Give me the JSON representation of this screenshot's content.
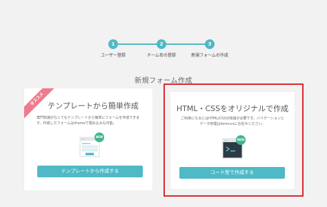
{
  "stepper": {
    "steps": [
      {
        "number": "1",
        "label": "ユーザー登録"
      },
      {
        "number": "2",
        "label": "チーム名の登録"
      },
      {
        "number": "3",
        "label": "新規フォームの作成"
      }
    ]
  },
  "section_title": "新規フォーム作成",
  "template_card": {
    "ribbon": "オススメ",
    "title": "テンプレートから簡単作成",
    "description": "専門知識がなくてもテンプレートから簡単にフォームを作成できます。作成したフォームはiframeで埋め込みも可能。",
    "new_badge": "NEW",
    "button_label": "テンプレートから作成する"
  },
  "code_card": {
    "title": "HTML・CSSをオリジナルで作成",
    "description": "ご利用になるにはHTML/CSSの知識が必要です。バリデーションとデータ管理はformrunにお任せください。",
    "new_badge": "NEW",
    "button_label": "コード型で作成する"
  },
  "colors": {
    "accent": "#4fb9c6",
    "ribbon": "#ef7c8e",
    "badge": "#3fb58f",
    "highlight": "#d9262c",
    "background": "#f2f2f2"
  },
  "icons": {
    "form_illustration": "form-window-icon",
    "terminal_illustration": "terminal-window-icon"
  }
}
